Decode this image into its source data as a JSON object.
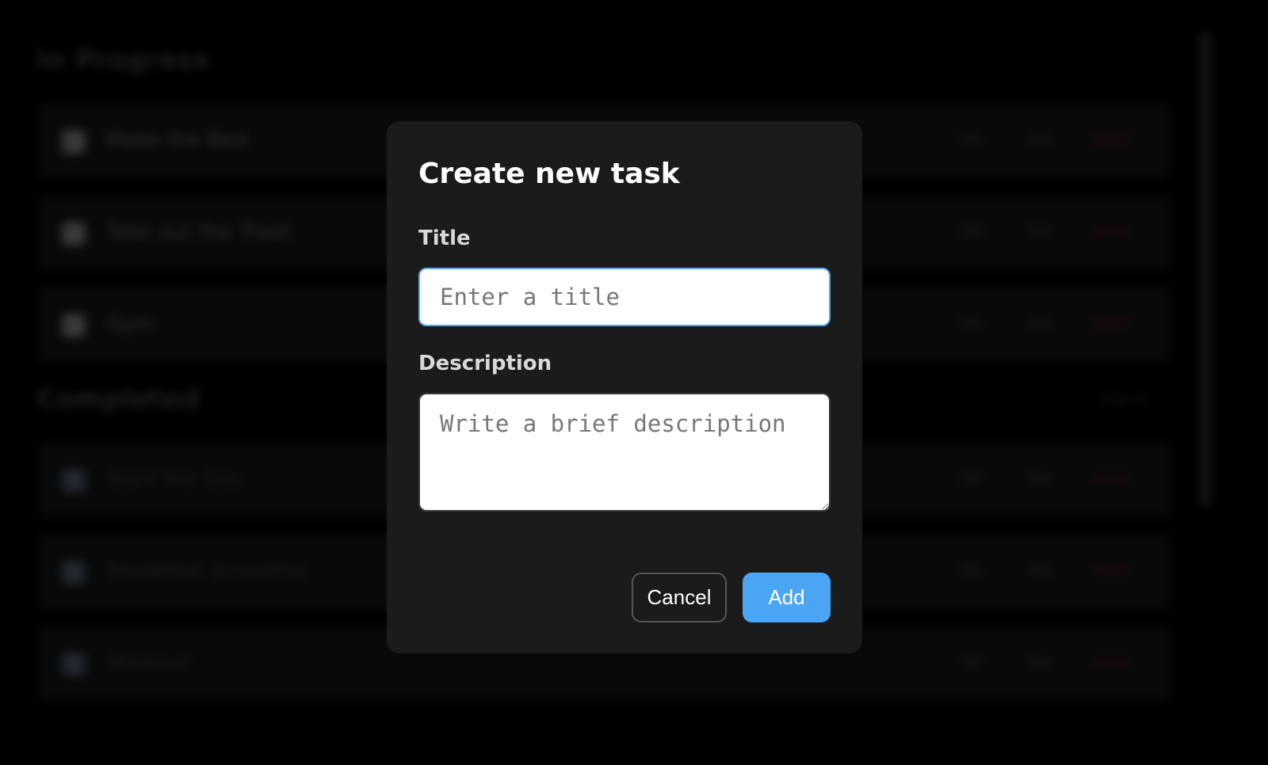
{
  "background": {
    "sections": [
      {
        "title": "In Progress",
        "tasks": [
          {
            "label": "Make the Bed",
            "actions": [
              "Edit",
              "Todo",
              "Delete"
            ]
          },
          {
            "label": "Take out the Trash",
            "actions": [
              "Edit",
              "Todo",
              "Delete"
            ]
          },
          {
            "label": "Gym",
            "actions": [
              "Edit",
              "Todo",
              "Delete"
            ]
          }
        ]
      },
      {
        "title": "Completed",
        "link": "View All",
        "tasks": [
          {
            "label": "Start the Day",
            "actions": [
              "Edit",
              "Todo",
              "Delete"
            ]
          },
          {
            "label": "Breakfast Smoothie",
            "actions": [
              "Edit",
              "Todo",
              "Delete"
            ]
          },
          {
            "label": "Workout",
            "actions": [
              "Edit",
              "Todo",
              "Delete"
            ]
          }
        ]
      }
    ]
  },
  "modal": {
    "title": "Create new task",
    "title_field": {
      "label": "Title",
      "value": "",
      "placeholder": "Enter a title"
    },
    "description_field": {
      "label": "Description",
      "value": "",
      "placeholder": "Write a brief description"
    },
    "cancel_label": "Cancel",
    "add_label": "Add"
  },
  "colors": {
    "accent": "#4aa6f5",
    "modal_bg": "#1b1b1b",
    "page_bg": "#000000",
    "danger": "#8b1a1a"
  }
}
